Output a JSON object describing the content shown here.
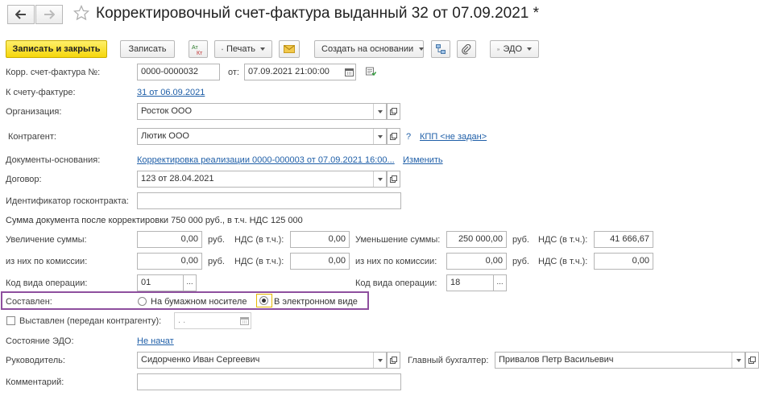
{
  "window": {
    "title": "Корректировочный счет-фактура выданный 32 от 07.09.2021 *"
  },
  "icons": {
    "back": "arrow-left-icon",
    "forward": "arrow-right-icon",
    "favorite": "star-icon"
  },
  "toolbar": {
    "save_close": "Записать и закрыть",
    "save": "Записать",
    "print": "Печать",
    "create_based": "Создать на основании",
    "edo": "ЭДО"
  },
  "form": {
    "corr_invoice_label": "Корр. счет-фактура №:",
    "corr_invoice_number": "0000-0000032",
    "from_label": "от:",
    "from_date": "07.09.2021 21:00:00",
    "to_invoice_label": "К счету-фактуре:",
    "to_invoice_link": "31 от 06.09.2021",
    "org_label": "Организация:",
    "org_value": "Росток ООО",
    "counterparty_label": "Контрагент:",
    "counterparty_value": "Лютик ООО",
    "question": "?",
    "kpp_link": "КПП <не задан>",
    "base_docs_label": "Документы-основания:",
    "base_docs_link": "Корректировка реализации 0000-000003 от 07.09.2021 16:00...",
    "change_link": "Изменить",
    "contract_label": "Договор:",
    "contract_value": "123 от 28.04.2021",
    "gov_contract_label": "Идентификатор госконтракта:",
    "gov_contract_value": "",
    "sum_summary": "Сумма документа после корректировки 750 000 руб., в т.ч. НДС 125 000",
    "increase_label": "Увеличение суммы:",
    "increase_value": "0,00",
    "rub1": "руб.",
    "vat_incl_label1": "НДС (в т.ч.):",
    "vat_incl_value1": "0,00",
    "decrease_label": "Уменьшение суммы:",
    "decrease_value": "250 000,00",
    "rub2": "руб.",
    "vat_incl_label2": "НДС (в т.ч.):",
    "vat_incl_value2": "41 666,67",
    "commission_label1": "из них по комиссии:",
    "commission_value1": "0,00",
    "rub3": "руб.",
    "vat_incl_label3": "НДС (в т.ч.):",
    "vat_incl_value3": "0,00",
    "commission_label2": "из них по комиссии:",
    "commission_value2": "0,00",
    "rub4": "руб.",
    "vat_incl_label4": "НДС (в т.ч.):",
    "vat_incl_value4": "0,00",
    "op_code_label1": "Код вида операции:",
    "op_code_value1": "01",
    "op_code_label2": "Код вида операции:",
    "op_code_value2": "18",
    "composed_label": "Составлен:",
    "paper_option": "На бумажном носителе",
    "electronic_option": "В электронном виде",
    "issued_label": "Выставлен (передан контрагенту):",
    "issued_date": " .  .",
    "edo_state_label": "Состояние ЭДО:",
    "edo_state_link": "Не начат",
    "head_label": "Руководитель:",
    "head_value": "Сидорченко Иван Сергеевич",
    "accountant_label": "Главный бухгалтер:",
    "accountant_value": "Привалов Петр Васильевич",
    "comment_label": "Комментарий:",
    "comment_value": ""
  },
  "colors": {
    "highlight_frame": "#8e4f9e",
    "primary_button": "#f5d60c",
    "link": "#1f5fa8"
  }
}
